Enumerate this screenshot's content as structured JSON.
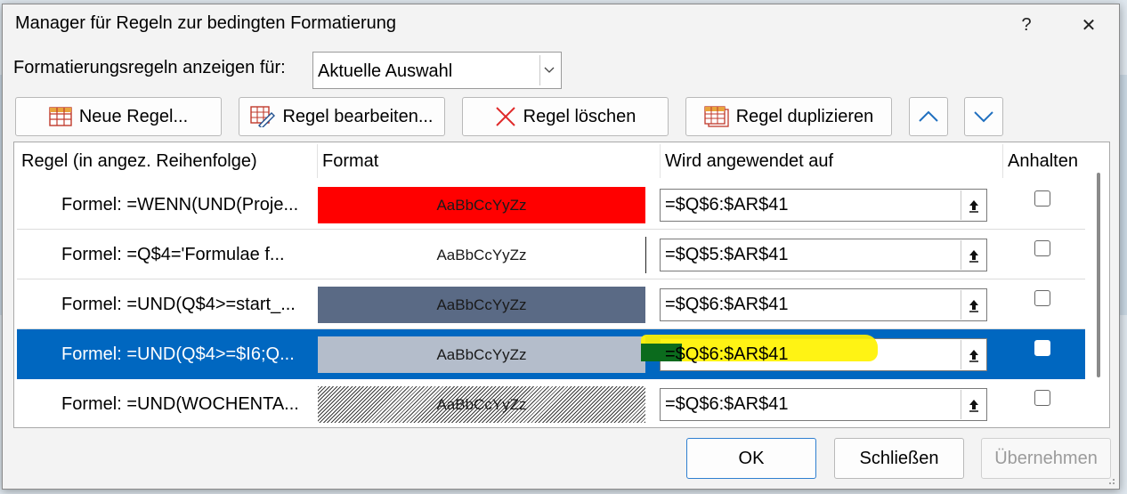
{
  "window": {
    "title": "Manager für Regeln zur bedingten Formatierung",
    "help": "?",
    "close": "✕"
  },
  "show_rules": {
    "label": "Formatierungsregeln anzeigen für:",
    "value": "Aktuelle Auswahl"
  },
  "toolbar": {
    "new_rule": "Neue Regel...",
    "edit_rule": "Regel bearbeiten...",
    "delete_rule": "Regel löschen",
    "duplicate_rule": "Regel duplizieren"
  },
  "table": {
    "headers": [
      "Regel (in angez. Reihenfolge)",
      "Format",
      "Wird angewendet auf",
      "Anhalten"
    ],
    "rows": [
      {
        "rule": "Formel: =WENN(UND(Proje...",
        "preview": "AaBbCcYyZz",
        "applies": "=$Q$6:$AR$41",
        "stop": false,
        "fill": "#ff0000"
      },
      {
        "rule": "Formel: =Q$4='Formulae f...",
        "preview": "AaBbCcYyZz",
        "applies": "=$Q$5:$AR$41",
        "stop": false,
        "fill": "#ffffff"
      },
      {
        "rule": "Formel: =UND(Q$4>=start_...",
        "preview": "AaBbCcYyZz",
        "applies": "=$Q$6:$AR$41",
        "stop": false,
        "fill": "#5a6a85"
      },
      {
        "rule": "Formel: =UND(Q$4>=$I6;Q...",
        "preview": "AaBbCcYyZz",
        "applies": "=$Q$6:$AR$41",
        "stop": false,
        "fill": "#b4bdcb",
        "selected": true
      },
      {
        "rule": "Formel: =UND(WOCHENTA...",
        "preview": "AaBbCcYyZz",
        "applies": "=$Q$6:$AR$41",
        "stop": false,
        "fill": "hatch"
      }
    ]
  },
  "footer": {
    "ok": "OK",
    "close": "Schließen",
    "apply": "Übernehmen"
  },
  "colors": {
    "accent": "#0067c0",
    "highlight": "#fff200"
  }
}
